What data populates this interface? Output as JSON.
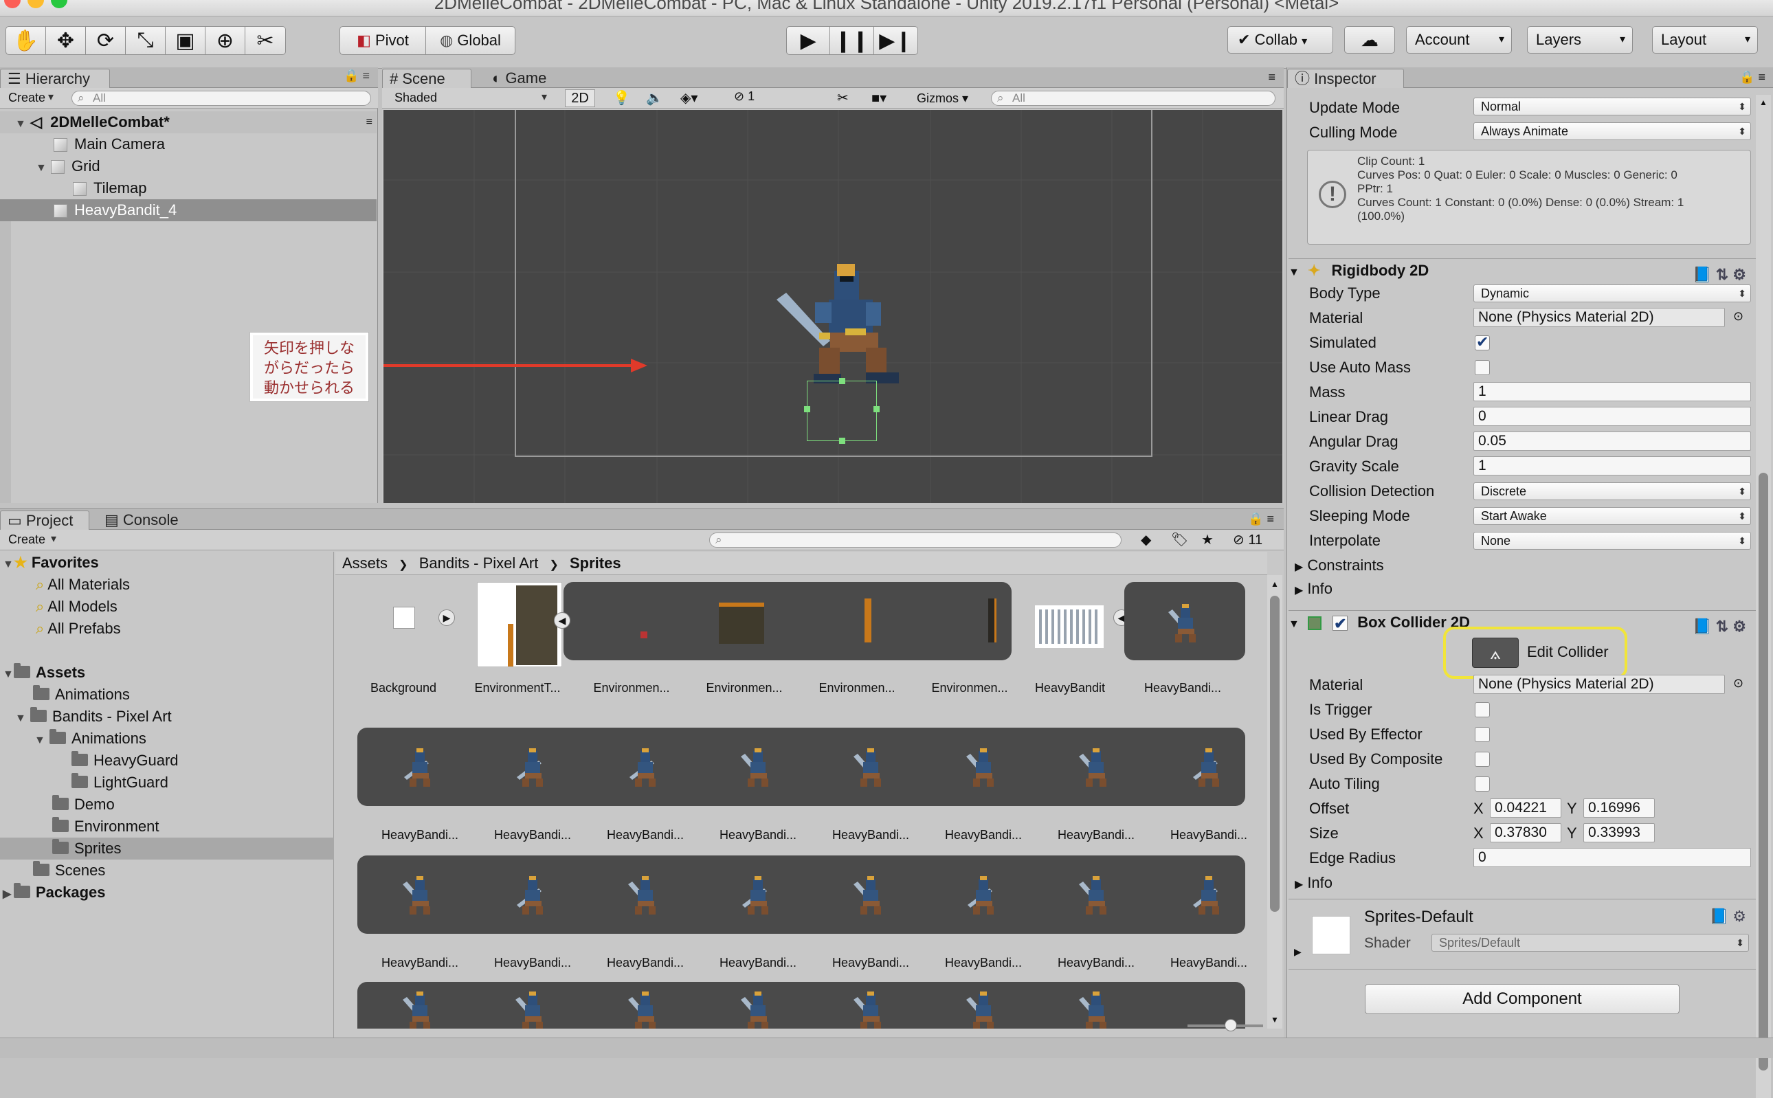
{
  "window": {
    "title": "2DMelleCombat - 2DMelleCombat - PC, Mac & Linux Standalone - Unity 2019.2.17f1 Personal (Personal) <Metal>"
  },
  "toolbar": {
    "tools": [
      "hand-tool",
      "move-tool",
      "rotate-tool",
      "scale-tool",
      "rect-tool",
      "transform-tool",
      "custom-tool"
    ],
    "pivot_label": "Pivot",
    "global_label": "Global",
    "collab_label": "Collab",
    "account_label": "Account",
    "layers_label": "Layers",
    "layout_label": "Layout"
  },
  "hierarchy": {
    "tab": "Hierarchy",
    "create_label": "Create",
    "search_placeholder": "All",
    "scene_name": "2DMelleCombat*",
    "items": [
      {
        "label": "Main Camera"
      },
      {
        "label": "Grid"
      },
      {
        "label": "Tilemap"
      },
      {
        "label": "HeavyBandit_4"
      }
    ]
  },
  "scene": {
    "tab_scene": "Scene",
    "tab_game": "Game",
    "shading": "Shaded",
    "mode_2d": "2D",
    "hidden_count": "1",
    "gizmos_label": "Gizmos",
    "search_placeholder": "All",
    "annotation": "矢印を押しな\nがらだったら\n動かせられる",
    "annotation_lines": [
      "矢印を押しな",
      "がらだったら",
      "動かせられる"
    ],
    "annotation_color": "#e03a2a"
  },
  "project": {
    "tab_project": "Project",
    "tab_console": "Console",
    "create_label": "Create",
    "hidden_count": "11",
    "favorites_label": "Favorites",
    "favorites": [
      "All Materials",
      "All Models",
      "All Prefabs"
    ],
    "assets_label": "Assets",
    "tree": [
      {
        "label": "Animations"
      },
      {
        "label": "Bandits - Pixel Art"
      },
      {
        "label": "Animations"
      },
      {
        "label": "HeavyGuard"
      },
      {
        "label": "LightGuard"
      },
      {
        "label": "Demo"
      },
      {
        "label": "Environment"
      },
      {
        "label": "Sprites"
      },
      {
        "label": "Scenes"
      }
    ],
    "packages_label": "Packages",
    "breadcrumb": [
      "Assets",
      "Bandits - Pixel Art",
      "Sprites"
    ],
    "row1_labels": [
      "Background",
      "EnvironmentT...",
      "Environmen...",
      "Environmen...",
      "Environmen...",
      "Environmen...",
      "HeavyBandit",
      "HeavyBandi..."
    ],
    "row2_labels": [
      "HeavyBandi...",
      "HeavyBandi...",
      "HeavyBandi...",
      "HeavyBandi...",
      "HeavyBandi...",
      "HeavyBandi...",
      "HeavyBandi...",
      "HeavyBandi..."
    ],
    "row3_labels": [
      "HeavyBandi...",
      "HeavyBandi...",
      "HeavyBandi...",
      "HeavyBandi...",
      "HeavyBandi...",
      "HeavyBandi...",
      "HeavyBandi...",
      "HeavyBandi..."
    ]
  },
  "inspector": {
    "tab": "Inspector",
    "animator": {
      "update_mode_label": "Update Mode",
      "update_mode": "Normal",
      "culling_mode_label": "Culling Mode",
      "culling_mode": "Always Animate",
      "info_lines": [
        "Clip Count: 1",
        "Curves Pos: 0 Quat: 0 Euler: 0 Scale: 0 Muscles: 0 Generic: 0",
        "PPtr: 1",
        "Curves Count: 1 Constant: 0 (0.0%) Dense: 0 (0.0%) Stream: 1",
        "(100.0%)"
      ]
    },
    "rigidbody": {
      "title": "Rigidbody 2D",
      "body_type_label": "Body Type",
      "body_type": "Dynamic",
      "material_label": "Material",
      "material": "None (Physics Material 2D)",
      "simulated_label": "Simulated",
      "simulated": true,
      "use_auto_mass_label": "Use Auto Mass",
      "use_auto_mass": false,
      "mass_label": "Mass",
      "mass": "1",
      "linear_drag_label": "Linear Drag",
      "linear_drag": "0",
      "angular_drag_label": "Angular Drag",
      "angular_drag": "0.05",
      "gravity_scale_label": "Gravity Scale",
      "gravity_scale": "1",
      "collision_detection_label": "Collision Detection",
      "collision_detection": "Discrete",
      "sleeping_mode_label": "Sleeping Mode",
      "sleeping_mode": "Start Awake",
      "interpolate_label": "Interpolate",
      "interpolate": "None",
      "constraints_label": "Constraints",
      "info_label": "Info"
    },
    "box_collider": {
      "title": "Box Collider 2D",
      "edit_collider_label": "Edit Collider",
      "highlight_color": "#f1e53a",
      "material_label": "Material",
      "material": "None (Physics Material 2D)",
      "is_trigger_label": "Is Trigger",
      "used_by_effector_label": "Used By Effector",
      "used_by_composite_label": "Used By Composite",
      "auto_tiling_label": "Auto Tiling",
      "offset_label": "Offset",
      "offset_x": "0.04221",
      "offset_y": "0.16996",
      "size_label": "Size",
      "size_x": "0.37830",
      "size_y": "0.33993",
      "edge_radius_label": "Edge Radius",
      "edge_radius": "0",
      "info_label": "Info",
      "x_label": "X",
      "y_label": "Y"
    },
    "material": {
      "name": "Sprites-Default",
      "shader_label": "Shader",
      "shader": "Sprites/Default"
    },
    "add_component_label": "Add Component"
  }
}
